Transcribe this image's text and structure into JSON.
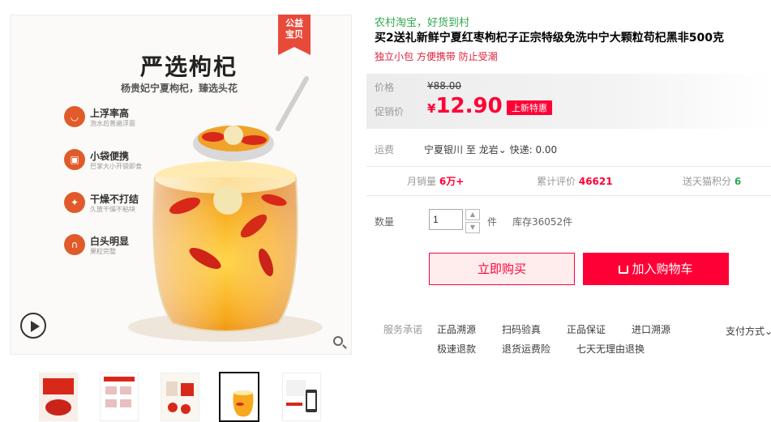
{
  "gallery": {
    "badge": [
      "公益",
      "宝贝"
    ],
    "hero_title": "严选枸杞",
    "hero_subtitle": "杨贵妃宁夏枸杞，臻选头花",
    "features": [
      {
        "title": "上浮率高",
        "sub": "泡水后普遍浮面"
      },
      {
        "title": "小袋便携",
        "sub": "巴掌大小开袋即食"
      },
      {
        "title": "干燥不打结",
        "sub": "久放干燥不粘块"
      },
      {
        "title": "白头明显",
        "sub": "果粒完整"
      }
    ],
    "thumb_count": 5,
    "active_thumb": 4
  },
  "product": {
    "tagline": "农村淘宝，好货到村",
    "title": "买2送礼新鲜宁夏红枣枸杞子正宗特级免洗中宁大颗粒苟杞黑非500克",
    "subtitle": "独立小包 方便携带 防止受潮"
  },
  "price": {
    "list_label": "价格",
    "list_value": "¥88.00",
    "promo_label": "促销价",
    "currency": "¥",
    "promo_value": "12.90",
    "promo_tag": "上新特惠"
  },
  "shipping": {
    "label": "运费",
    "from": "宁夏银川",
    "to_word": "至",
    "dest": "龙岩",
    "express": "快递: 0.00"
  },
  "stats": {
    "monthly_label": "月销量",
    "monthly_value": "6万+",
    "reviews_label": "累计评价",
    "reviews_value": "46621",
    "points_label": "送天猫积分",
    "points_value": "6"
  },
  "quantity": {
    "label": "数量",
    "value": "1",
    "unit": "件",
    "stock": "库存36052件"
  },
  "actions": {
    "buy_now": "立即购买",
    "add_cart": "加入购物车"
  },
  "services": {
    "label": "服务承诺",
    "items": [
      "正品溯源",
      "扫码验真",
      "正品保证",
      "进口溯源",
      "极速退款",
      "退货运费险",
      "七天无理由退换"
    ],
    "payment": "支付方式"
  },
  "colors": {
    "accent": "#ff0036",
    "green": "#2fa84f"
  }
}
